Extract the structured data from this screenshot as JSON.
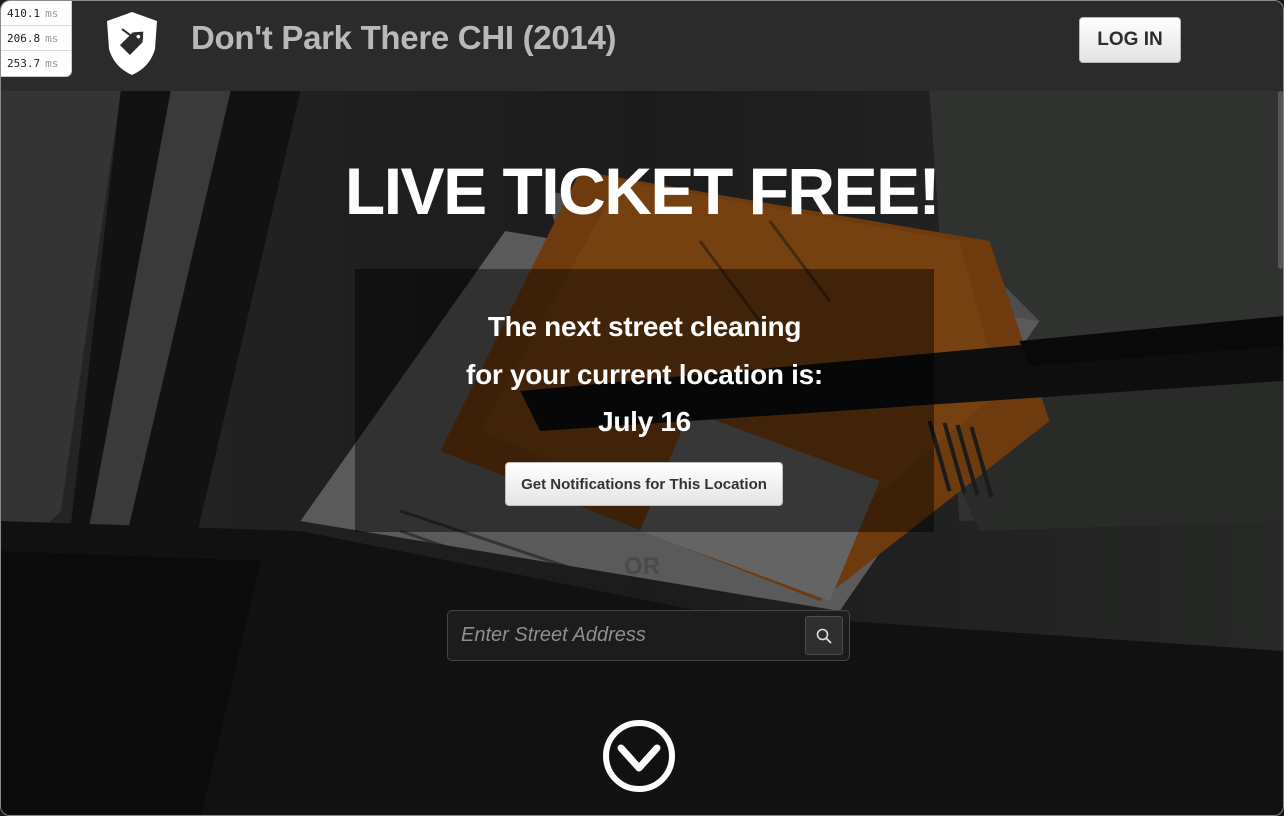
{
  "perf_timings": [
    {
      "value": "410.1",
      "unit": "ms"
    },
    {
      "value": "206.8",
      "unit": "ms"
    },
    {
      "value": "253.7",
      "unit": "ms"
    }
  ],
  "header": {
    "logo_icon": "shield-tag-icon",
    "brand": "Don't Park There CHI (2014)",
    "login_label": "LOG IN"
  },
  "hero": {
    "headline": "LIVE TICKET FREE!",
    "panel": {
      "line1": "The next street cleaning",
      "line2": "for your current location is:",
      "date": "July 16",
      "button_label": "Get Notifications for This Location"
    },
    "or_label": "OR",
    "search": {
      "value": "",
      "placeholder": "Enter Street Address",
      "button_icon": "search-icon"
    },
    "scroll_icon": "chevron-down-circle-icon"
  },
  "colors": {
    "navbar_bg": "#2b2b2b",
    "brand_text": "#b9b9b9",
    "ticket_orange": "#c8701e",
    "headline_text": "#ffffff"
  }
}
